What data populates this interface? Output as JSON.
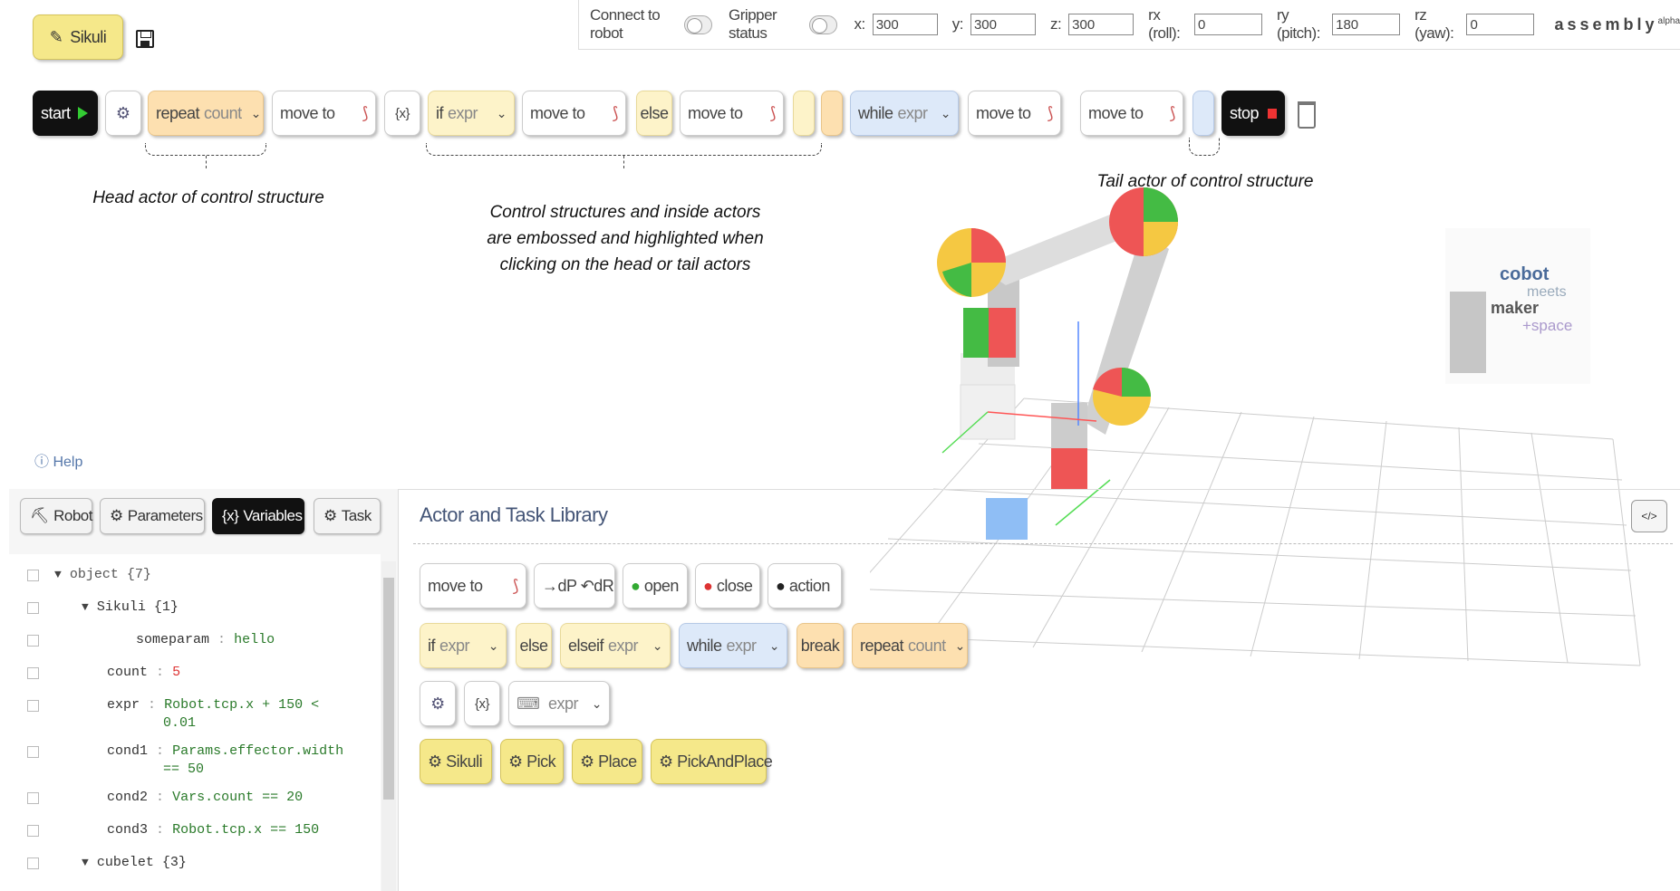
{
  "topbar": {
    "connect_label": "Connect to robot",
    "gripper_label": "Gripper status",
    "x_label": "x:",
    "x_value": "300",
    "y_label": "y:",
    "y_value": "300",
    "z_label": "z:",
    "z_value": "300",
    "rx_label": "rx (roll):",
    "rx_value": "0",
    "ry_label": "ry (pitch):",
    "ry_value": "180",
    "rz_label": "rz (yaw):",
    "rz_value": "0",
    "brand": "assembly",
    "brand_sup": "alpha"
  },
  "task": {
    "name": "Sikuli"
  },
  "sequence": {
    "start": "start",
    "repeat": "repeat",
    "repeat_arg": "count",
    "move": "move to",
    "if": "if",
    "if_arg": "expr",
    "else": "else",
    "while": "while",
    "while_arg": "expr",
    "stop": "stop",
    "var": "{x}"
  },
  "annotations": {
    "head": "Head actor of control structure",
    "middle_1": "Control structures and inside actors",
    "middle_2": "are embossed and highlighted when",
    "middle_3": "clicking on the head or tail actors",
    "tail": "Tail actor of control structure"
  },
  "help": "Help",
  "poster": {
    "l1": "cobot",
    "l2": "meets",
    "l3": "maker",
    "l4": "+space"
  },
  "tabs": {
    "robot": "Robot",
    "params": "Parameters",
    "vars": "Variables",
    "task": "Task"
  },
  "tree": {
    "object": "object {7}",
    "sikuli": "Sikuli {1}",
    "someparam_k": "someparam",
    "someparam_v": "hello",
    "count_k": "count",
    "count_v": "5",
    "expr_k": "expr",
    "expr_v1": "Robot.tcp.x + 150 <",
    "expr_v2": "0.01",
    "cond1_k": "cond1",
    "cond1_v1": "Params.effector.width",
    "cond1_v2": "== 50",
    "cond2_k": "cond2",
    "cond2_v": "Vars.count == 20",
    "cond3_k": "cond3",
    "cond3_v": "Robot.tcp.x == 150",
    "cubelet": "cubelet {3}"
  },
  "library": {
    "title": "Actor and Task Library",
    "move": "move to",
    "dp": "→dP ↶dR",
    "open": "open",
    "close": "close",
    "action": "action",
    "if": "if",
    "if_arg": "expr",
    "else": "else",
    "elseif": "elseif",
    "elseif_arg": "expr",
    "while": "while",
    "while_arg": "expr",
    "break": "break",
    "repeat": "repeat",
    "repeat_arg": "count",
    "var": "{x}",
    "expr": "expr",
    "tasks": [
      "Sikuli",
      "Pick",
      "Place",
      "PickAndPlace"
    ]
  },
  "colors": {
    "actor_yellow": "#f5e88a",
    "repeat_orange": "#fde0b0",
    "while_blue": "#dde9f9",
    "if_yellow": "#fdf3c9"
  }
}
